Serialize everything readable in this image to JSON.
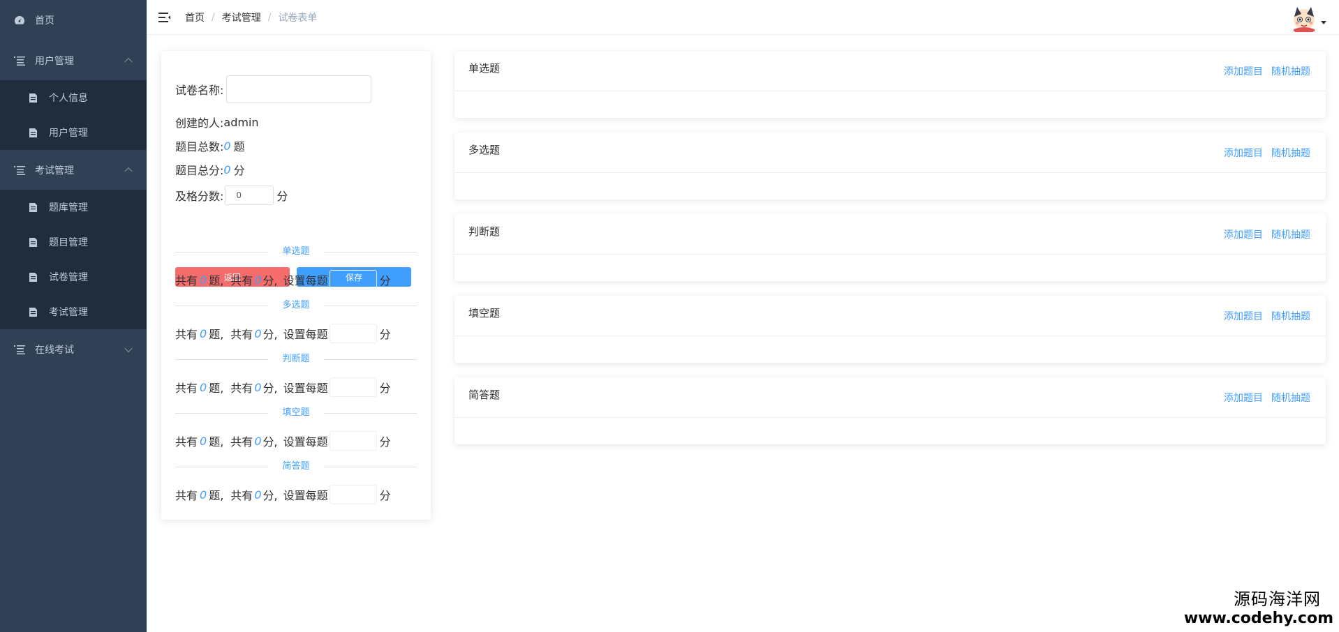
{
  "sidebar": {
    "home": "首页",
    "user_mgmt": "用户管理",
    "user_sub": [
      "个人信息",
      "用户管理"
    ],
    "exam_mgmt": "考试管理",
    "exam_sub": [
      "题库管理",
      "题目管理",
      "试卷管理",
      "考试管理"
    ],
    "online_exam": "在线考试"
  },
  "header": {
    "breadcrumb": [
      "首页",
      "考试管理",
      "试卷表单"
    ]
  },
  "form": {
    "name_label": "试卷名称:",
    "name_value": "",
    "creator_label": "创建的人:",
    "creator_value": "admin",
    "total_q_label": "题目总数:",
    "total_q_value": "0",
    "total_q_unit": "题",
    "total_score_label": "题目总分:",
    "total_score_value": "0",
    "total_score_unit": "分",
    "pass_label": "及格分数:",
    "pass_value": "0",
    "pass_unit": "分",
    "back_button": "返回",
    "save_button": "保存",
    "sections": [
      {
        "title": "单选题",
        "count": "0",
        "score": "0"
      },
      {
        "title": "多选题",
        "count": "0",
        "score": "0"
      },
      {
        "title": "判断题",
        "count": "0",
        "score": "0"
      },
      {
        "title": "填空题",
        "count": "0",
        "score": "0"
      },
      {
        "title": "简答题",
        "count": "0",
        "score": "0"
      }
    ],
    "row_text": {
      "total": "共有",
      "q_unit": "题,",
      "score_unit": "分,",
      "set_each": "设置每题",
      "fen": "分"
    }
  },
  "panels": {
    "titles": [
      "单选题",
      "多选题",
      "判断题",
      "填空题",
      "简答题"
    ],
    "add_link": "添加题目",
    "random_link": "随机抽题"
  },
  "watermark": {
    "cn": "源码海洋网",
    "url": "www.codehy.com"
  },
  "colors": {
    "sidebar_bg": "#304156",
    "submenu_bg": "#1f2d3d",
    "primary": "#409eff",
    "danger": "#f56c6c"
  }
}
